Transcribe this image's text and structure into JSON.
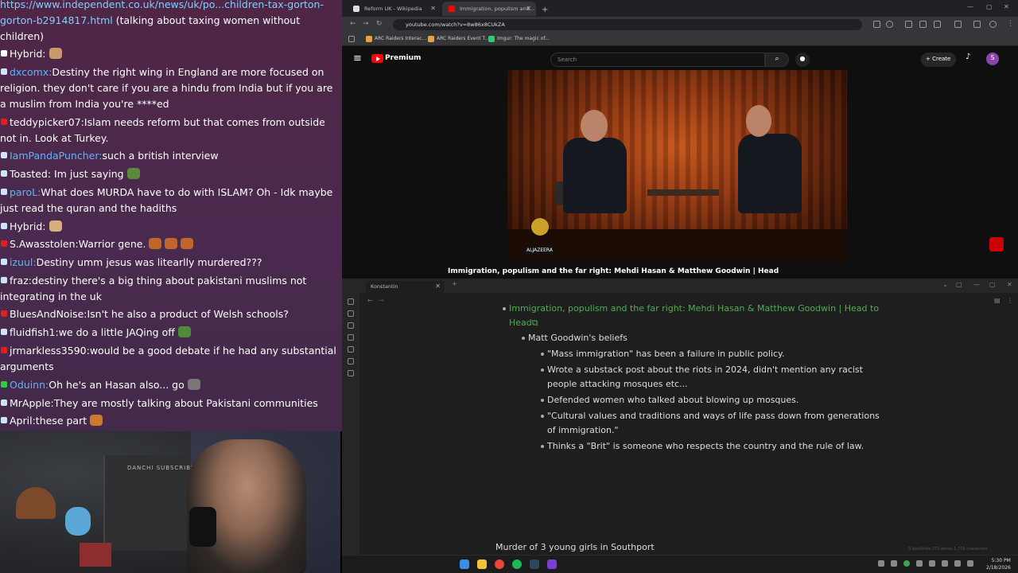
{
  "chat": {
    "top_link_url": "https://www.independent.co.uk/news/uk/po...children-tax-gorton-gorton-b2914817.html",
    "top_link_text": " (talking about taxing women without children)",
    "messages": [
      {
        "user": "Hybrid:",
        "text": "",
        "color": "#ffffff",
        "badge": "#ffffff"
      },
      {
        "user": "dxcomx:",
        "text": "Destiny the right wing in England are more focused on religion. they don't care if you are a hindu from India but if you are a muslim from India you're ****ed",
        "color": "#5bb5ff",
        "badge": "#cde4ff"
      },
      {
        "user": "teddypicker07:",
        "text": "Islam needs reform but that comes from outside not in. Look at Turkey.",
        "color": "#ffffff",
        "badge": "#e02020"
      },
      {
        "user": "IamPandaPuncher:",
        "text": "such a british interview",
        "color": "#5bb5ff",
        "badge": "#cde4ff"
      },
      {
        "user": "Toasted:",
        "text": " Im just saying",
        "color": "#ffffff",
        "badge": "#cde4ff"
      },
      {
        "user": "paroL:",
        "text": "What does MURDA have to do with ISLAM? Oh - Idk maybe just read the quran and the hadiths",
        "color": "#5bb5ff",
        "badge": "#cde4ff"
      },
      {
        "user": "Hybrid:",
        "text": "",
        "color": "#ffffff",
        "badge": "#cde4ff"
      },
      {
        "user": "S.Awasstolen:",
        "text": "Warrior gene.",
        "color": "#ffffff",
        "badge": "#e02020"
      },
      {
        "user": "izuul:",
        "text": "Destiny umm jesus was litearlly murdered???",
        "color": "#5bb5ff",
        "badge": "#cde4ff"
      },
      {
        "user": "fraz:",
        "text": "destiny there's a big thing about pakistani muslims not integrating in the uk",
        "color": "#ffffff",
        "badge": "#cde4ff"
      },
      {
        "user": "BluesAndNoise:",
        "text": "Isn't he also a product of Welsh schools?",
        "color": "#ffffff",
        "badge": "#e02020"
      },
      {
        "user": "fluidfish1:",
        "text": "we do a little JAQing off",
        "color": "#ffffff",
        "badge": "#cde4ff"
      },
      {
        "user": "jrmarkless3590:",
        "text": "would be a good debate if he had any substantial arguments",
        "color": "#ffffff",
        "badge": "#e02020"
      },
      {
        "user": "Oduinn:",
        "text": "Oh he's an Hasan also... go",
        "color": "#5bb5ff",
        "badge": "#2ecc40"
      },
      {
        "user": "MrApple:",
        "text": "They are mostly talking about Pakistani communities",
        "color": "#ffffff",
        "badge": "#cde4ff"
      },
      {
        "user": "April:",
        "text": "these part",
        "color": "#ffffff",
        "badge": "#cde4ff"
      }
    ]
  },
  "webcam": {
    "logo_text": "DANCHI SUBSCRIBE"
  },
  "browser": {
    "tabs": [
      {
        "title": "Reform UK - Wikipedia",
        "active": false
      },
      {
        "title": "Immigration, populism and...",
        "active": true
      }
    ],
    "new_tab": "+",
    "url": "youtube.com/watch?v=8w86x8CUkZA",
    "bookmarks": [
      "ARC Raiders Interac...",
      "ARC Raiders Event T...",
      "Imgur: The magic of..."
    ]
  },
  "youtube": {
    "brand": "Premium",
    "search_placeholder": "Search",
    "create_label": "Create",
    "avatar_letter": "S",
    "video_title": "Immigration, populism and the far right: Mehdi Hasan & Matthew Goodwin | Head",
    "channel_watermark": "ALJAZEERA"
  },
  "notes": {
    "tab_title": "Konstantin",
    "lines": [
      {
        "text": "Immigration, populism and the far right: Mehdi Hasan & Matthew Goodwin | Head to",
        "kind": "link",
        "indent": 0
      },
      {
        "text": "Head",
        "kind": "link",
        "indent": 0
      },
      {
        "text": "Matt Goodwin's beliefs",
        "kind": "text",
        "indent": 1
      },
      {
        "text": "\"Mass immigration\" has been a failure in public policy.",
        "kind": "text",
        "indent": 2
      },
      {
        "text": "Wrote a substack post about the riots in 2024, didn't mention any racist",
        "kind": "text",
        "indent": 2
      },
      {
        "text": "people attacking mosques etc...",
        "kind": "text",
        "indent": 2
      },
      {
        "text": "Defended women who talked about blowing up mosques.",
        "kind": "text",
        "indent": 2
      },
      {
        "text": "\"Cultural values and traditions and ways of life pass down from generations",
        "kind": "text",
        "indent": 2
      },
      {
        "text": "of immigration.\"",
        "kind": "text",
        "indent": 2
      },
      {
        "text": "Thinks a \"Brit\" is someone who respects the country and the rule of law.",
        "kind": "text",
        "indent": 2
      },
      {
        "text": "Murder of 3 young girls in Southport",
        "kind": "text",
        "indent": 0
      }
    ],
    "status": "0 backlinks   272 words   1,716 characters"
  },
  "taskbar": {
    "time": "5:30 PM",
    "date": "2/18/2026"
  }
}
